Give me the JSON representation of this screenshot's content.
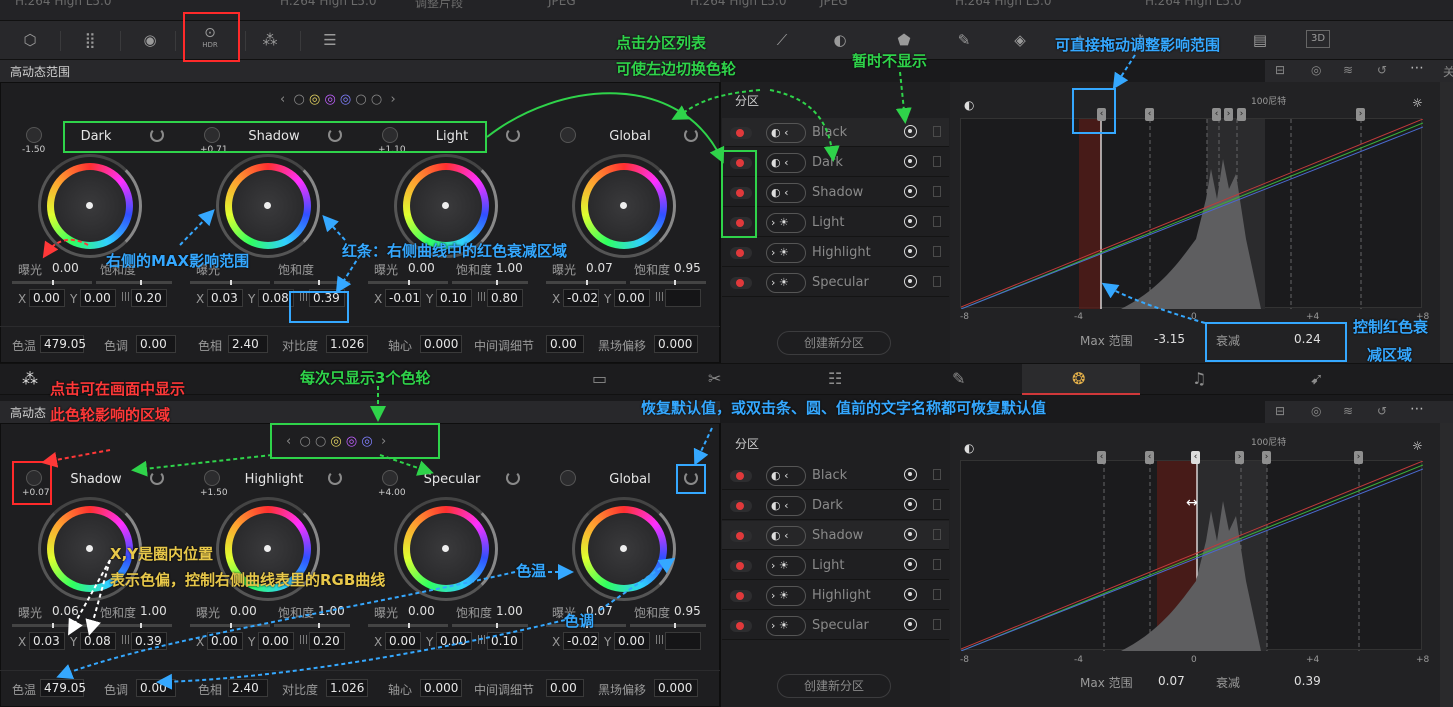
{
  "top_strip": [
    "H.264 High L5.0",
    "H.264 High L5.0",
    "调整片段",
    "JPEG",
    "H.264 High L5.0",
    "JPEG",
    "H.264 High L5.0",
    "H.264 High L5.0"
  ],
  "toolbar": {
    "hdr_label": "HDR",
    "threed": "3D"
  },
  "upper": {
    "title": "高动态范围",
    "wheels": [
      {
        "name": "Dark",
        "knob": "-1.50",
        "exposure": "0.00",
        "sat": "",
        "x": "0.00",
        "y": "0.00",
        "range": "0.20"
      },
      {
        "name": "Shadow",
        "knob": "+0.71",
        "exposure": "",
        "sat": "",
        "x": "0.03",
        "y": "0.08",
        "range": "0.39"
      },
      {
        "name": "Light",
        "knob": "+1.10",
        "exposure": "0.00",
        "sat": "1.00",
        "x": "-0.01",
        "y": "0.10",
        "range": "0.80"
      },
      {
        "name": "Global",
        "knob": "",
        "exposure": "0.07",
        "sat": "0.95",
        "x": "-0.02",
        "y": "0.00",
        "range": ""
      }
    ],
    "labels": {
      "exposure": "曝光",
      "sat": "饱和度",
      "sat_mid": "饱和度",
      "x": "X",
      "y": "Y"
    },
    "footer": {
      "temp_label": "色温",
      "temp": "479.05",
      "tint_label": "色调",
      "tint": "0.00",
      "hue_label": "色相",
      "hue": "2.40",
      "contrast_label": "对比度",
      "contrast": "1.026",
      "pivot_label": "轴心",
      "pivot": "0.000",
      "mid_label": "中间调细节",
      "mid": "0.00",
      "black_label": "黑场偏移",
      "black": "0.000"
    },
    "zones_title": "分区",
    "zones": [
      "Black",
      "Dark",
      "Shadow",
      "Light",
      "Highlight",
      "Specular"
    ],
    "create_btn": "创建新分区",
    "graph": {
      "nits": "100尼特",
      "ticks": [
        "-8",
        "-4",
        "0",
        "+4",
        "+8"
      ],
      "max_label": "Max 范围",
      "max": "-3.15",
      "falloff_label": "衰减",
      "falloff": "0.24"
    }
  },
  "lower": {
    "title": "高动态",
    "wheels": [
      {
        "name": "Shadow",
        "knob": "+0.07",
        "exposure": "0.06",
        "sat": "1.00",
        "x": "0.03",
        "y": "0.08",
        "range": "0.39"
      },
      {
        "name": "Highlight",
        "knob": "+1.50",
        "exposure": "0.00",
        "sat": "1.00",
        "x": "0.00",
        "y": "0.00",
        "range": "0.20"
      },
      {
        "name": "Specular",
        "knob": "+4.00",
        "exposure": "0.00",
        "sat": "1.00",
        "x": "0.00",
        "y": "0.00",
        "range": "0.10"
      },
      {
        "name": "Global",
        "knob": "",
        "exposure": "0.07",
        "sat": "0.95",
        "x": "-0.02",
        "y": "0.00",
        "range": ""
      }
    ],
    "footer": {
      "temp": "479.05",
      "tint": "0.00",
      "hue": "2.40",
      "contrast": "1.026",
      "pivot": "0.000",
      "mid": "0.00",
      "black": "0.000"
    },
    "zones": [
      "Black",
      "Dark",
      "Shadow",
      "Light",
      "Highlight",
      "Specular"
    ],
    "create_btn": "创建新分区",
    "graph": {
      "nits": "100尼特",
      "ticks": [
        "-8",
        "-4",
        "0",
        "+4",
        "+8"
      ],
      "max_label": "Max 范围",
      "max": "0.07",
      "falloff_label": "衰减",
      "falloff": "0.39"
    }
  },
  "annotations": {
    "zone_list": "点击分区列表",
    "zone_list2": "可使左边切换色轮",
    "hide": "暂时不显示",
    "drag": "可直接拖动调整影响范围",
    "max_range": "右侧的MAX影响范围",
    "red_bar": "红条：右侧曲线中的红色衰减区域",
    "falloff_ctrl": "控制红色衰",
    "falloff_ctrl2": "减区域",
    "show_area": "点击可在画面中显示",
    "show_area2": "此色轮影响的区域",
    "three": "每次只显示3个色轮",
    "reset": "恢复默认值，或双击条、圆、值前的文字名称都可恢复默认值",
    "xy": "X,Y是圈内位置",
    "xy2": "表示色偏，控制右侧曲线表里的RGB曲线",
    "temp": "色温",
    "tint": "色调"
  },
  "colors": {
    "green": "#2fd34a",
    "blue": "#35a8ff",
    "red": "#ff3838"
  }
}
